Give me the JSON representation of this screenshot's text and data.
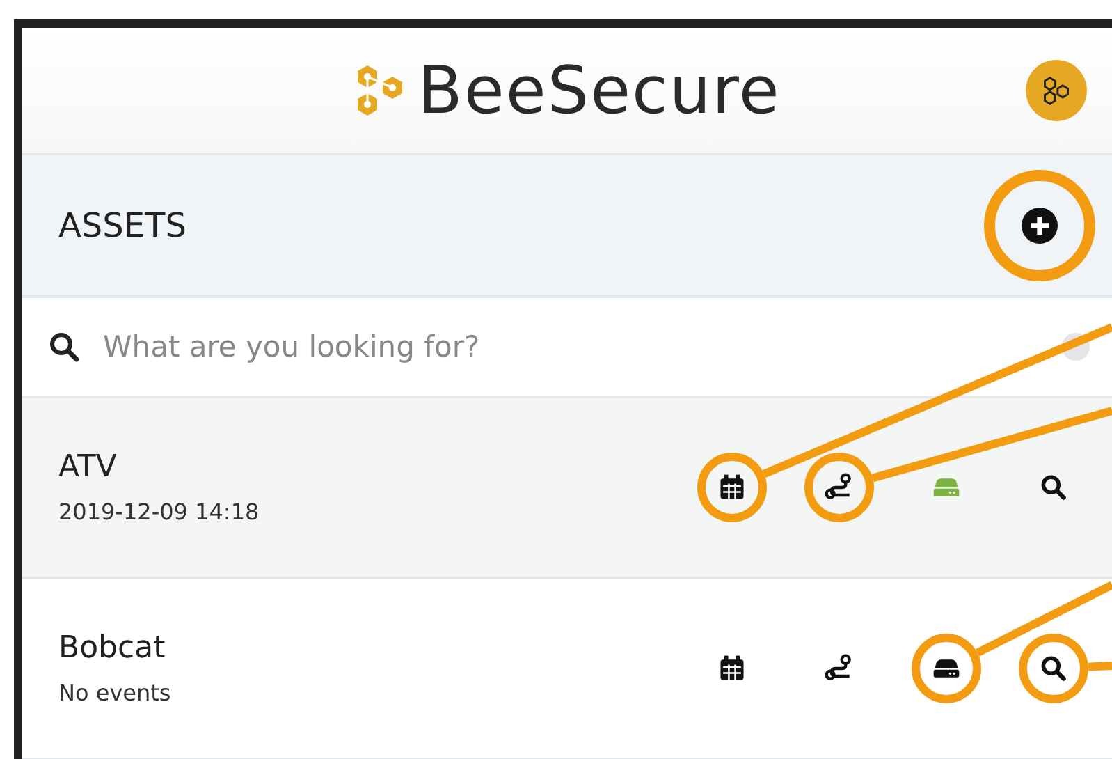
{
  "app": {
    "title": "BeeSecure"
  },
  "section": {
    "title": "ASSETS",
    "add_highlighted": true
  },
  "search": {
    "placeholder": "What are you looking for?"
  },
  "assets": [
    {
      "name": "ATV",
      "last_event": "2019-12-09 14:18",
      "color": "#7cb342",
      "actions": [
        {
          "kind": "calendar",
          "highlighted": true
        },
        {
          "kind": "route",
          "highlighted": true
        },
        {
          "kind": "device",
          "highlighted": false
        },
        {
          "kind": "search",
          "highlighted": false
        }
      ]
    },
    {
      "name": "Bobcat",
      "last_event": "No events",
      "color": "#111111",
      "actions": [
        {
          "kind": "calendar",
          "highlighted": false
        },
        {
          "kind": "route",
          "highlighted": false
        },
        {
          "kind": "device",
          "highlighted": true
        },
        {
          "kind": "search",
          "highlighted": true
        }
      ]
    }
  ]
}
